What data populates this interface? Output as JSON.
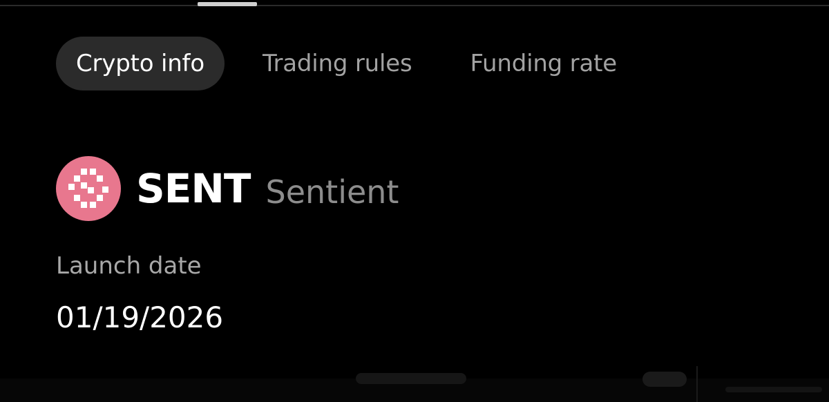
{
  "tabs": [
    {
      "label": "Crypto info",
      "active": true
    },
    {
      "label": "Trading rules",
      "active": false
    },
    {
      "label": "Funding rate",
      "active": false
    }
  ],
  "coin": {
    "symbol": "SENT",
    "name": "Sentient",
    "logo_icon": "sentient-logo-icon",
    "logo_color": "#e8778e"
  },
  "fields": {
    "launch_date": {
      "label": "Launch date",
      "value": "01/19/2026"
    }
  }
}
